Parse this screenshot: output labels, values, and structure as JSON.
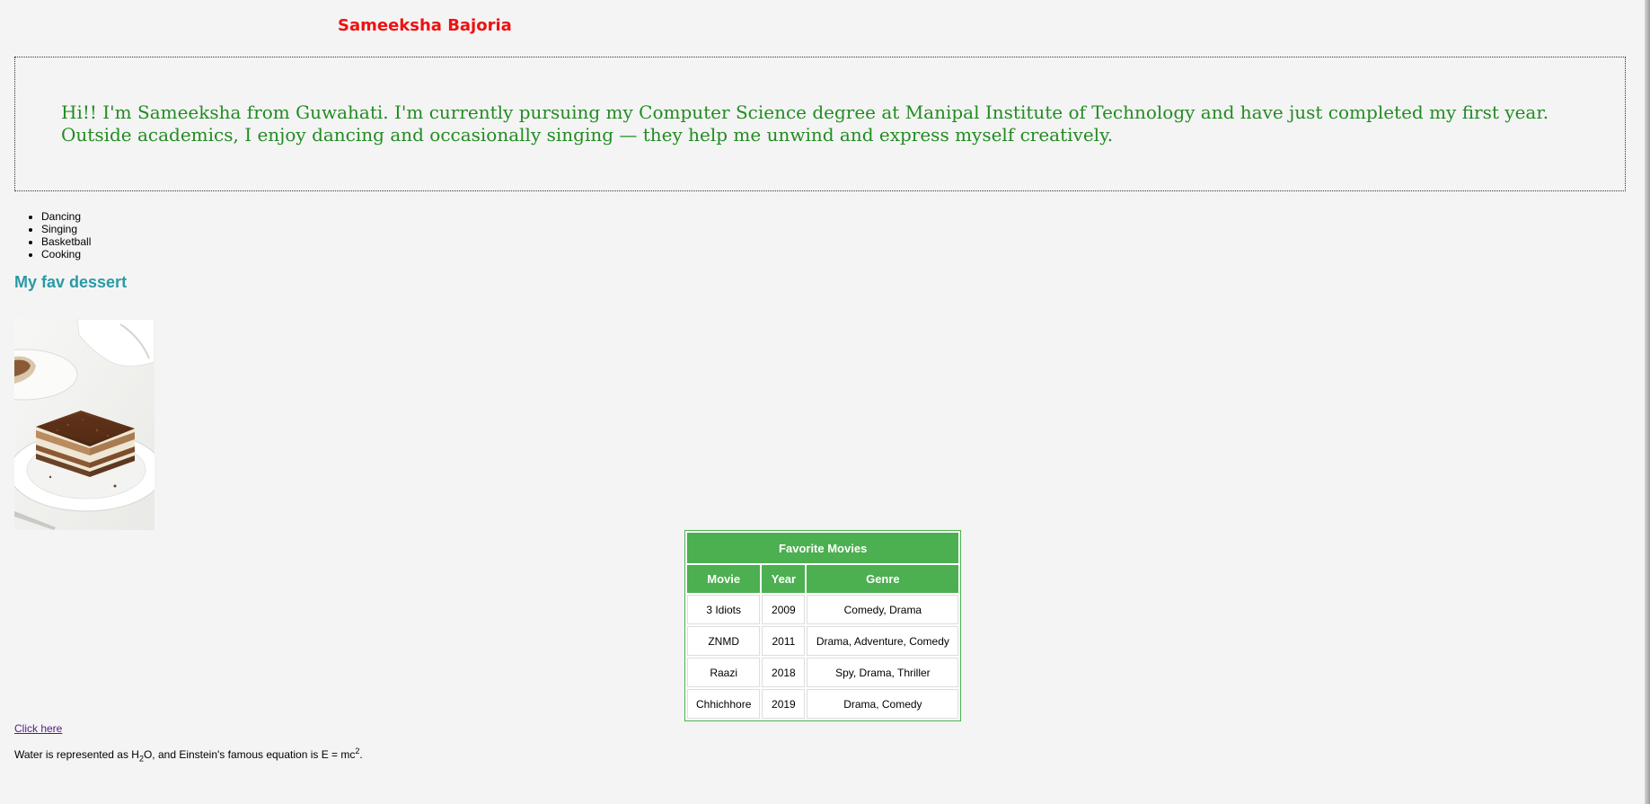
{
  "page": {
    "title": "Sameeksha Bajoria"
  },
  "intro": {
    "text": "Hi!! I'm Sameeksha from Guwahati. I'm currently pursuing my Computer Science degree at Manipal Institute of Technology and have just completed my first year. Outside academics, I enjoy dancing and occasionally singing — they help me unwind and express myself creatively."
  },
  "hobbies": [
    "Dancing",
    "Singing",
    "Basketball",
    "Cooking"
  ],
  "dessert": {
    "heading": "My fav dessert",
    "image_icon": "tiramisu-cake-image"
  },
  "movies": {
    "caption": "Favorite Movies",
    "headers": [
      "Movie",
      "Year",
      "Genre"
    ],
    "rows": [
      [
        "3 Idiots",
        "2009",
        "Comedy, Drama"
      ],
      [
        "ZNMD",
        "2011",
        "Drama, Adventure, Comedy"
      ],
      [
        "Raazi",
        "2018",
        "Spy, Drama, Thriller"
      ],
      [
        "Chhichhore",
        "2019",
        "Drama, Comedy"
      ]
    ]
  },
  "link": {
    "label": "Click here"
  },
  "equation": {
    "part1": "Water is represented as H",
    "sub": "2",
    "part2": "O, and Einstein's famous equation is E = mc",
    "sup": "2",
    "part3": "."
  },
  "colors": {
    "title": "#ee1111",
    "intro": "#228b22",
    "heading": "#2a9aa5",
    "table_header": "#4caf50",
    "link": "#551a8b",
    "background": "#f4f4f4"
  }
}
